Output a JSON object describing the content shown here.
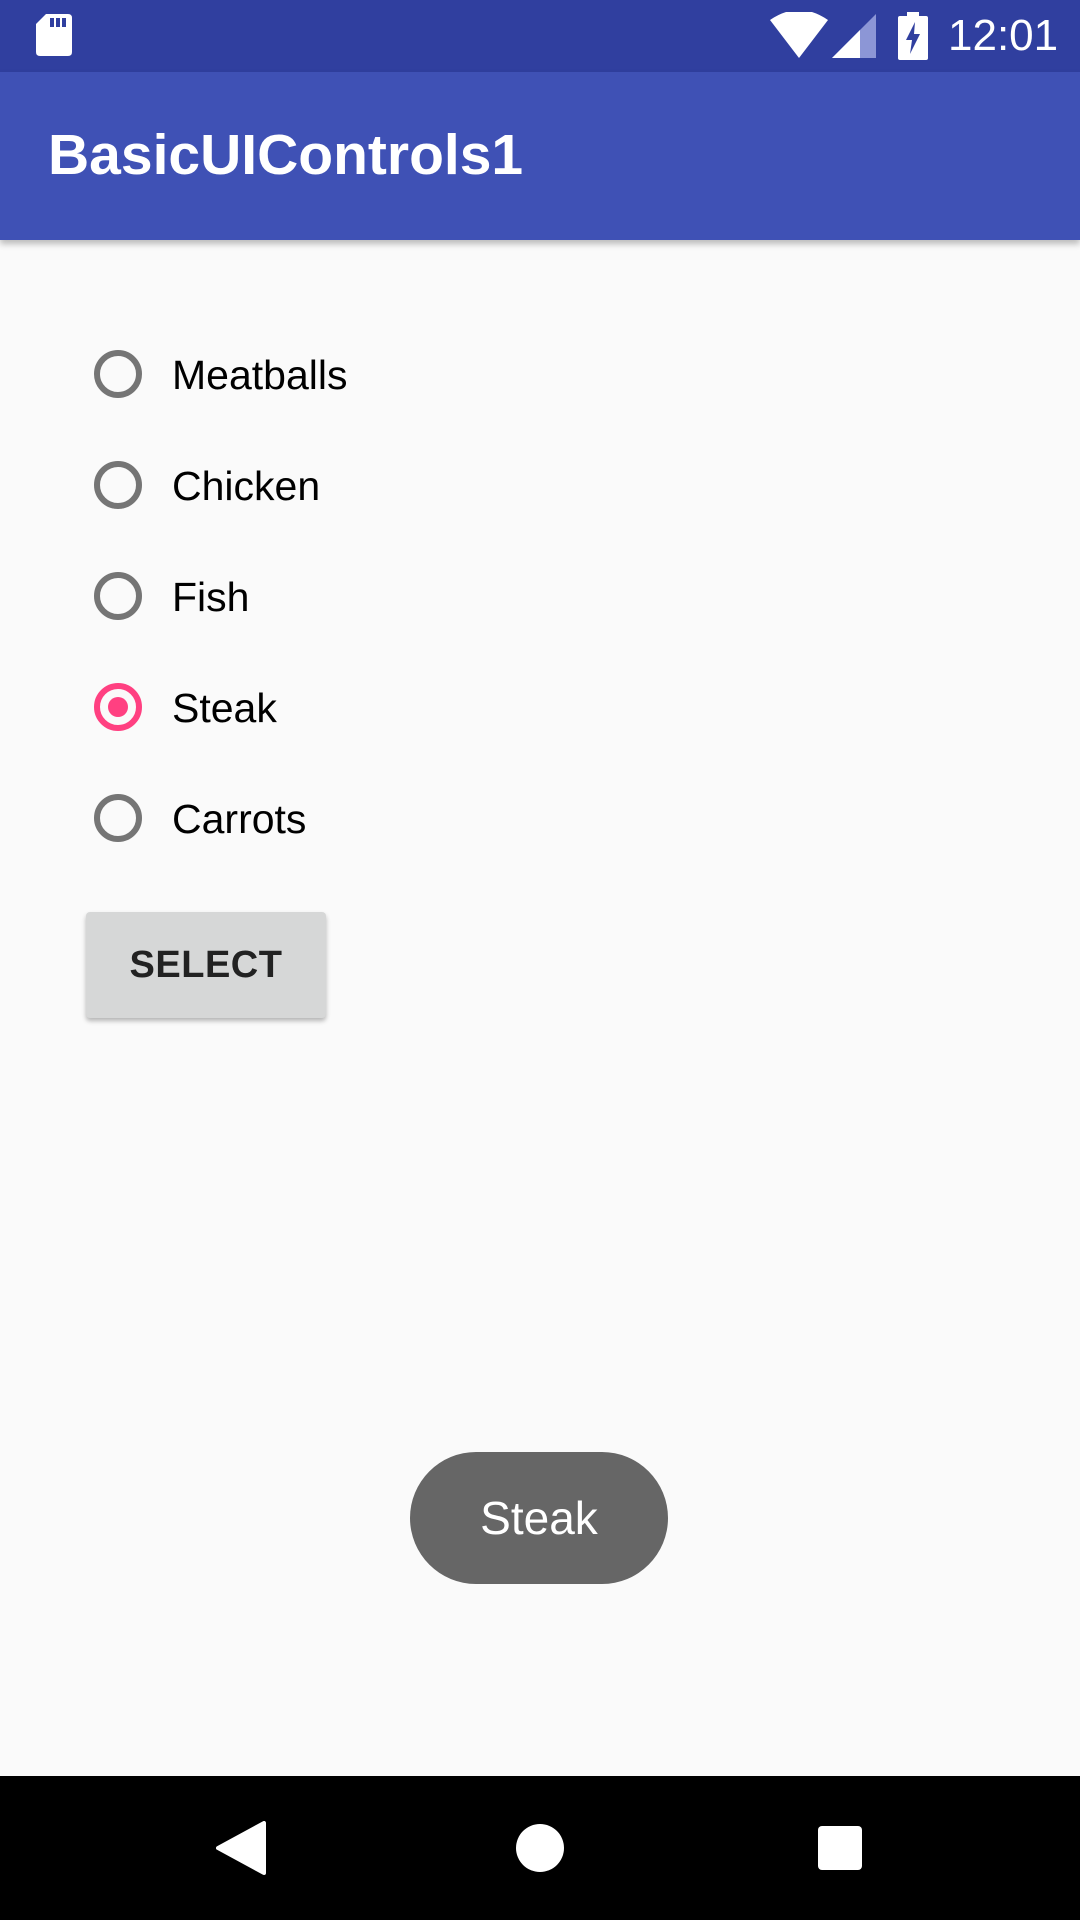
{
  "status_bar": {
    "time": "12:01",
    "icons": [
      "sd-card-icon",
      "wifi-icon",
      "signal-icon",
      "battery-charging-icon"
    ]
  },
  "app_bar": {
    "title": "BasicUIControls1"
  },
  "radio_group": {
    "options": [
      {
        "label": "Meatballs",
        "checked": false
      },
      {
        "label": "Chicken",
        "checked": false
      },
      {
        "label": "Fish",
        "checked": false
      },
      {
        "label": "Steak",
        "checked": true
      },
      {
        "label": "Carrots",
        "checked": false
      }
    ]
  },
  "select_button": {
    "label": "SELECT"
  },
  "toast": {
    "text": "Steak"
  },
  "nav_bar": {
    "icons": [
      "back-icon",
      "home-icon",
      "recents-icon"
    ]
  },
  "colors": {
    "status_bar": "#303f9f",
    "app_bar": "#3f51b5",
    "accent": "#ff4081",
    "toast": "#666666"
  }
}
